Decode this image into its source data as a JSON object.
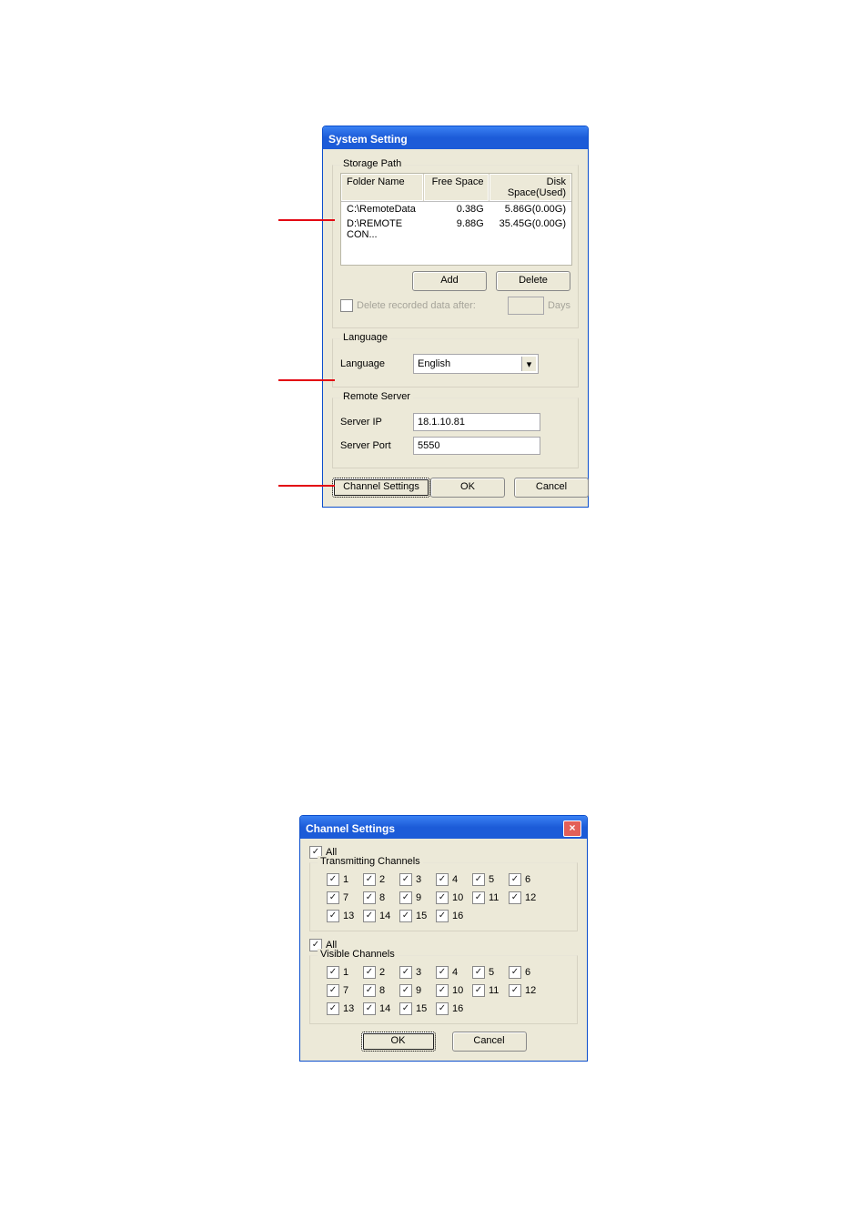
{
  "system_setting": {
    "title": "System Setting",
    "storage_path": {
      "legend": "Storage Path",
      "columns": {
        "folder": "Folder Name",
        "free": "Free Space",
        "used": "Disk Space(Used)"
      },
      "rows": [
        {
          "folder": "C:\\RemoteData",
          "free": "0.38G",
          "used": "5.86G(0.00G)"
        },
        {
          "folder": "D:\\REMOTE CON...",
          "free": "9.88G",
          "used": "35.45G(0.00G)"
        }
      ],
      "add_btn": "Add",
      "delete_btn": "Delete",
      "delete_after_label": "Delete recorded data after:",
      "days_label": "Days",
      "days_value": ""
    },
    "language": {
      "legend": "Language",
      "label": "Language",
      "value": "English"
    },
    "remote_server": {
      "legend": "Remote Server",
      "ip_label": "Server IP",
      "ip_value": "18.1.10.81",
      "port_label": "Server Port",
      "port_value": "5550"
    },
    "channel_settings_btn": "Channel Settings",
    "ok_btn": "OK",
    "cancel_btn": "Cancel"
  },
  "channel_settings": {
    "title": "Channel Settings",
    "all_label": "All",
    "transmitting_legend": "Transmitting Channels",
    "visible_legend": "Visible Channels",
    "channels": [
      "1",
      "2",
      "3",
      "4",
      "5",
      "6",
      "7",
      "8",
      "9",
      "10",
      "11",
      "12",
      "13",
      "14",
      "15",
      "16"
    ],
    "ok_btn": "OK",
    "cancel_btn": "Cancel"
  }
}
